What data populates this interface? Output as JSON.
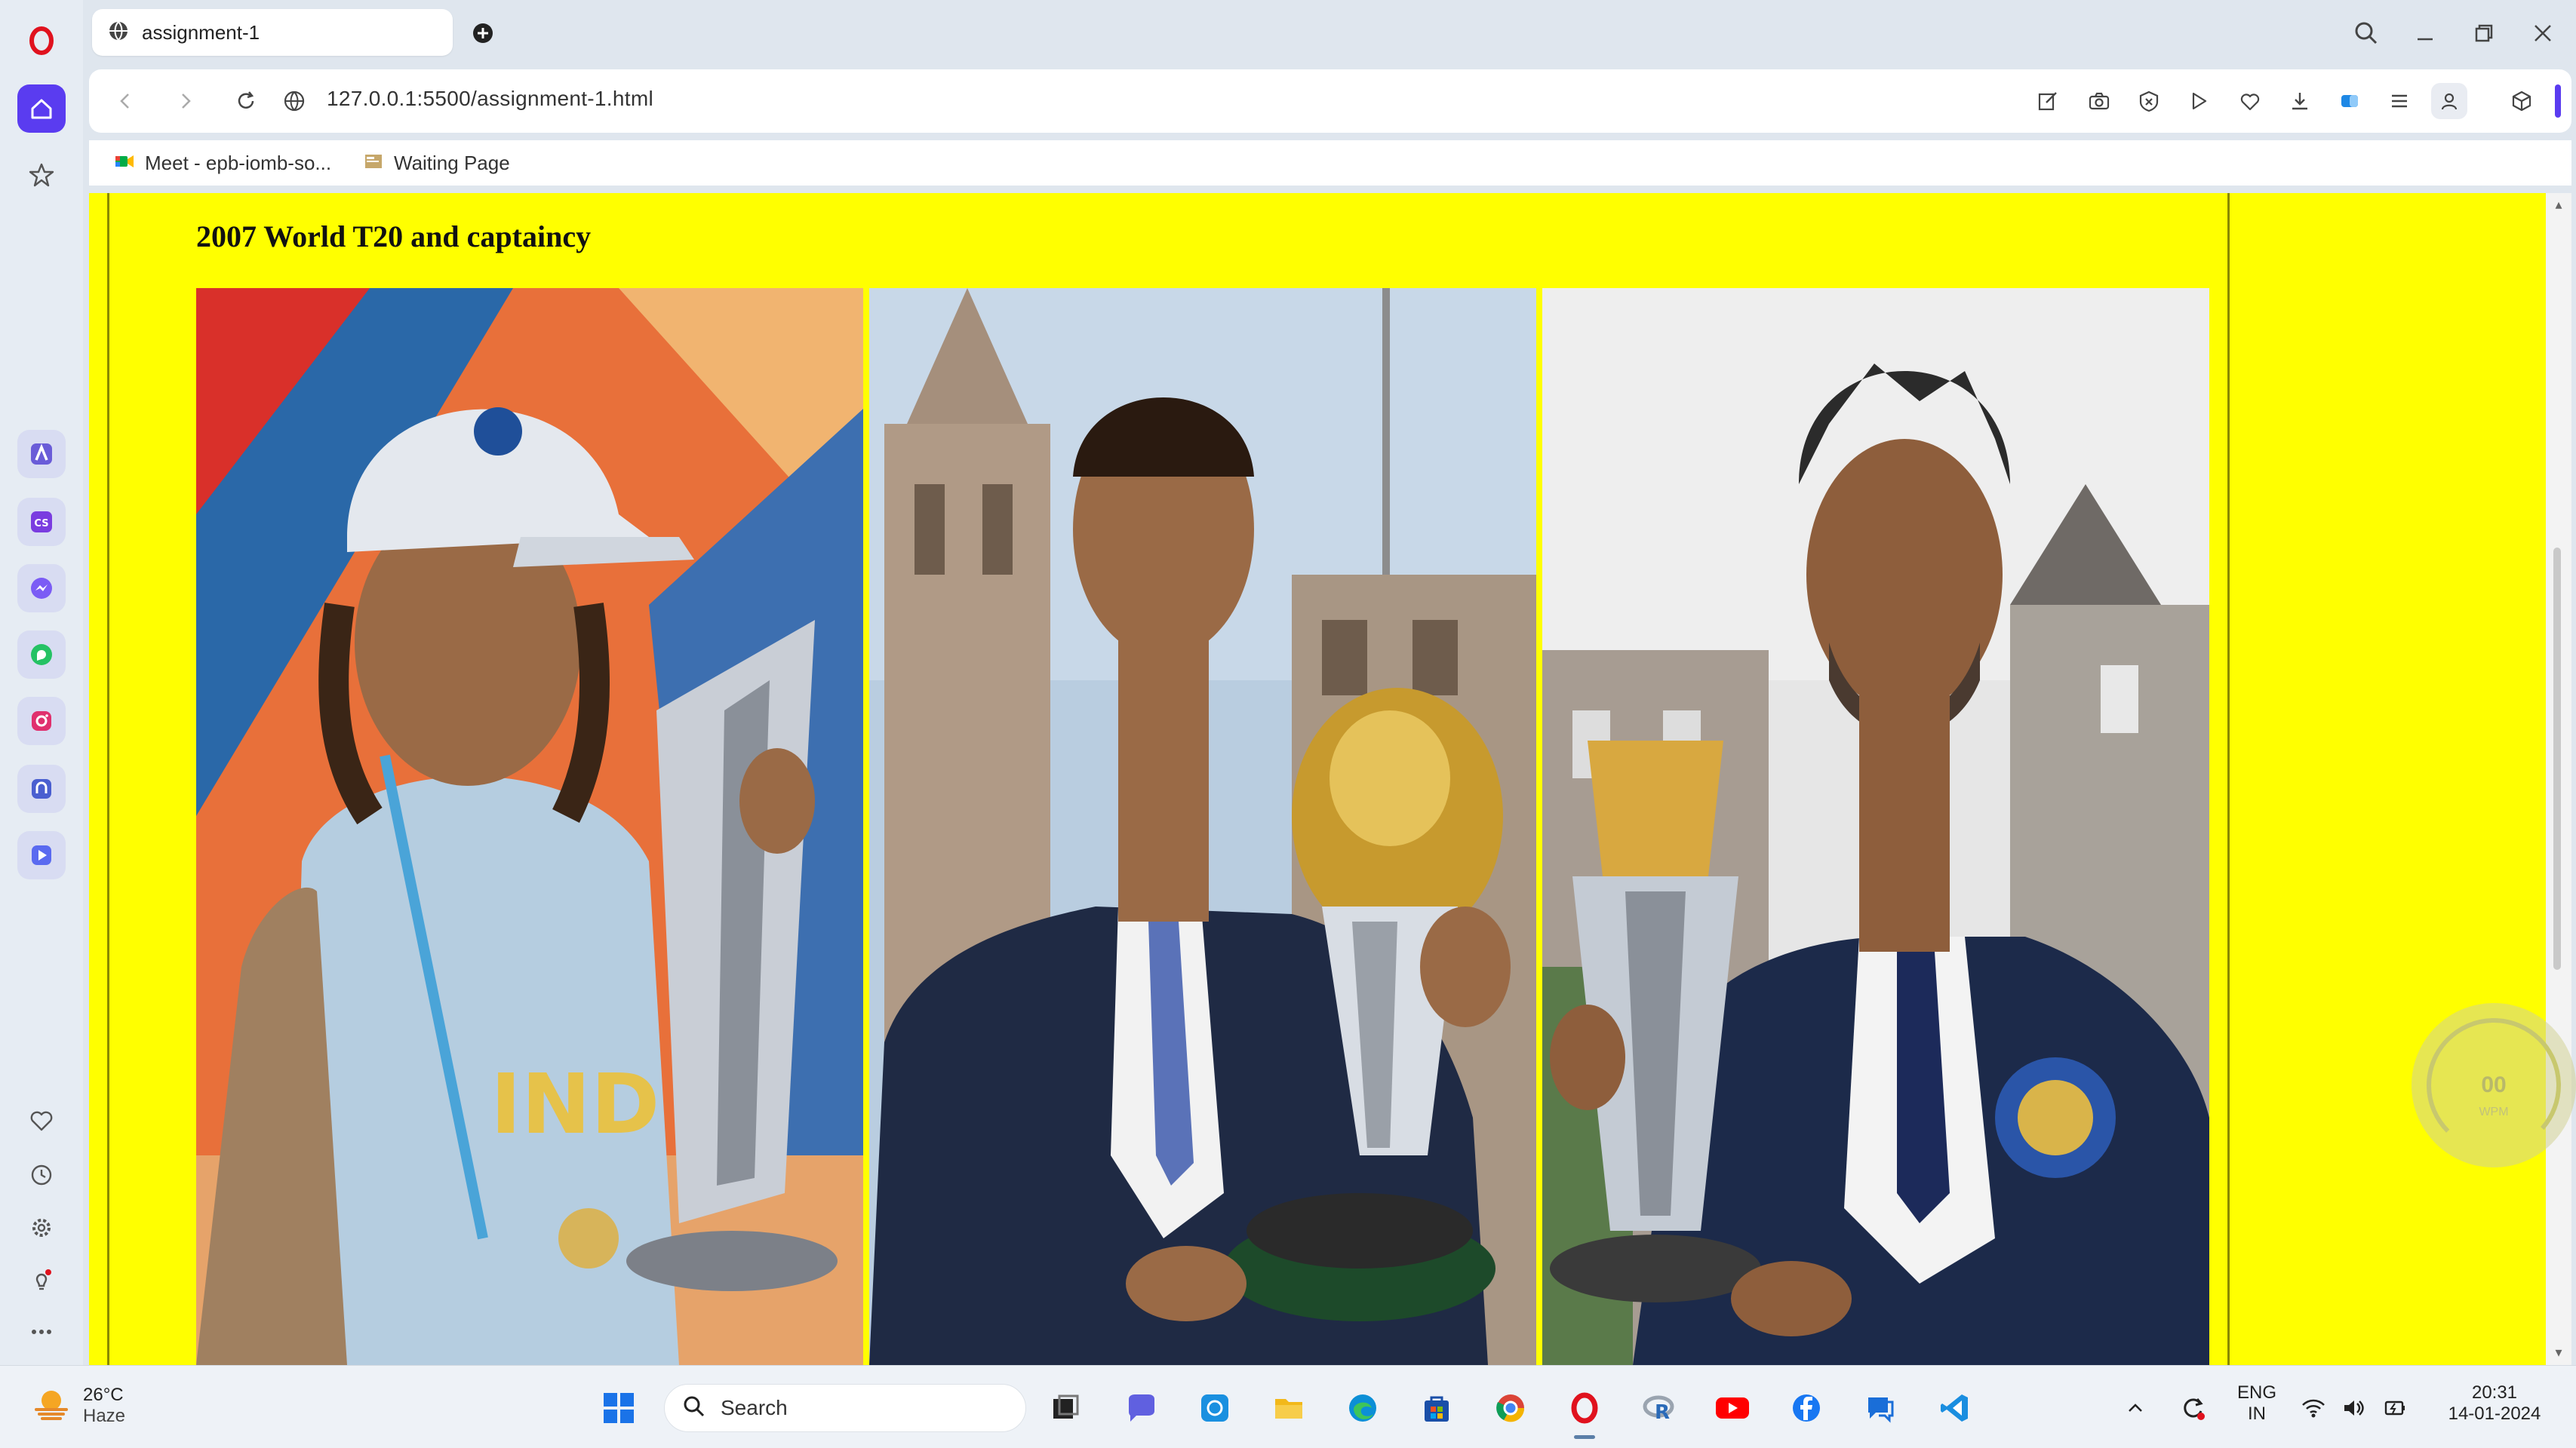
{
  "browser": {
    "tab": {
      "title": "assignment-1"
    },
    "address": {
      "url": "127.0.0.1:5500/assignment-1.html"
    },
    "bookmarks": [
      {
        "label": "Meet - epb-iomb-so..."
      },
      {
        "label": "Waiting Page"
      }
    ]
  },
  "page": {
    "heading": "2007 World T20 and captaincy",
    "images": [
      {
        "name": "photo-t20-trophy"
      },
      {
        "name": "photo-world-cup-trophy"
      },
      {
        "name": "photo-champions-trophy"
      }
    ]
  },
  "widget": {
    "speed_value": "00",
    "speed_unit": "WPM"
  },
  "taskbar": {
    "weather": {
      "temp": "26°C",
      "condition": "Haze"
    },
    "search_placeholder": "Search",
    "language": {
      "lang": "ENG",
      "region": "IN"
    },
    "clock": {
      "time": "20:31",
      "date": "14-01-2024"
    }
  },
  "colors": {
    "page_background": "#ffff00",
    "opera_red": "#e0121e",
    "sidebar_accent": "#5a3cf0"
  }
}
